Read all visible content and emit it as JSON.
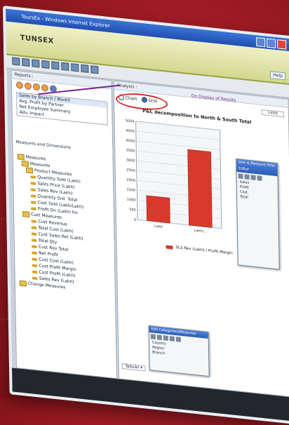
{
  "window": {
    "title": "ToursEx - Windows Internet Explorer"
  },
  "brand": {
    "logo": "TUNSEX",
    "help_label": "Help"
  },
  "left_panel": {
    "reports_title": "Reports :",
    "report_items": [
      "Sales by Branch / Month",
      "Avg. Profit by Partner",
      "Net Employee Summary",
      "Adv. Impact"
    ],
    "dimensions_title": "Measures and Dimensions",
    "tree": [
      {
        "level": 0,
        "kind": "folder",
        "label": "Measures"
      },
      {
        "level": 1,
        "kind": "folder",
        "label": "Measures"
      },
      {
        "level": 2,
        "kind": "folder",
        "label": "Product Measures"
      },
      {
        "level": 3,
        "kind": "key",
        "label": "Quantity Sold (Lakh)"
      },
      {
        "level": 3,
        "kind": "key",
        "label": "Sales Price (Lakh)"
      },
      {
        "level": 3,
        "kind": "key",
        "label": "Sales Rev (Lakh)"
      },
      {
        "level": 3,
        "kind": "key",
        "label": "Quantity Ord. Total"
      },
      {
        "level": 3,
        "kind": "key",
        "label": "Cost Sold (Lakh/Lakh)"
      },
      {
        "level": 3,
        "kind": "key",
        "label": "Profit On (Lakh) for"
      },
      {
        "level": 1,
        "kind": "folder",
        "label": "Cust Measures"
      },
      {
        "level": 3,
        "kind": "key",
        "label": "Cust Revenue"
      },
      {
        "level": 3,
        "kind": "key",
        "label": "Total Cust (Lakh) "
      },
      {
        "level": 3,
        "kind": "key",
        "label": "Cust Sales Ret (Lakh)"
      },
      {
        "level": 3,
        "kind": "key",
        "label": "Total Qty"
      },
      {
        "level": 3,
        "kind": "key",
        "label": "Cust Rev Total"
      },
      {
        "level": 3,
        "kind": "key",
        "label": "Net Profit"
      },
      {
        "level": 3,
        "kind": "key",
        "label": "Cust Cost (Lakh)"
      },
      {
        "level": 3,
        "kind": "key",
        "label": "Cust Profit Margin"
      },
      {
        "level": 3,
        "kind": "key",
        "label": "Cust Profit (Lakh)"
      },
      {
        "level": 3,
        "kind": "key",
        "label": "Sales Rev (Lakh)"
      },
      {
        "level": 0,
        "kind": "folder",
        "label": "Change Measures"
      }
    ]
  },
  "main_panel": {
    "section_title": "Analysis :",
    "view_options": [
      "Chart",
      "Grid"
    ],
    "selected_view": "Grid",
    "callout": "On Display of Results",
    "chart_title": "P&L decomposition to North & South Total",
    "legend_label": "SLS Rev (Lakh) / Profit Margin",
    "side_dropdown": "Limit",
    "bottom_dropdown": "Tabular ▾"
  },
  "chart_data": {
    "type": "bar",
    "categories": [
      "Lakh",
      "Lakh/..."
    ],
    "values": [
      1280,
      3850
    ],
    "ylim": [
      0,
      5000
    ],
    "yticks": [
      0,
      500,
      1000,
      1500,
      2000,
      2500,
      3000,
      3500,
      4000,
      4500,
      5000
    ],
    "colors": {
      "bar": "#d8392b",
      "grid": "#c9d1da"
    }
  },
  "popups": {
    "right_title": "Dim & Measure Filter Editor",
    "right_items": [
      "Sales",
      "Profit",
      "Cost",
      "Total"
    ],
    "bottom_title": "Edit Categories/Measures",
    "bottom_items": [
      "Country",
      "Region",
      "Branch"
    ]
  }
}
